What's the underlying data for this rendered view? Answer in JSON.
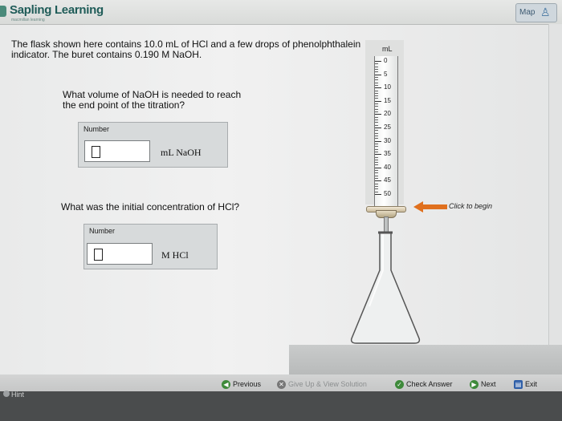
{
  "header": {
    "brand": "Sapling Learning",
    "brand_sub": "macmillan learning",
    "map_label": "Map"
  },
  "question": {
    "intro": "The flask shown here contains 10.0 mL of HCl and a few drops of phenolphthalein indicator. The buret contains 0.190 M NaOH.",
    "part1": "What volume of NaOH is needed to reach the end point of the titration?",
    "part1_box_label": "Number",
    "part1_value": "",
    "part1_unit": "mL NaOH",
    "part2": "What was the initial concentration of HCl?",
    "part2_box_label": "Number",
    "part2_value": "",
    "part2_unit": "M HCl"
  },
  "buret": {
    "unit": "mL",
    "ticks": [
      "0",
      "5",
      "10",
      "15",
      "20",
      "25",
      "30",
      "35",
      "40",
      "45",
      "50"
    ]
  },
  "action": {
    "click_to_begin": "Click to begin"
  },
  "footer": {
    "previous": "Previous",
    "give_up": "Give Up & View Solution",
    "check_answer": "Check Answer",
    "next": "Next",
    "exit": "Exit",
    "hint": "Hint"
  },
  "colors": {
    "brand": "#1f5c58",
    "arrow": "#e0701e"
  }
}
